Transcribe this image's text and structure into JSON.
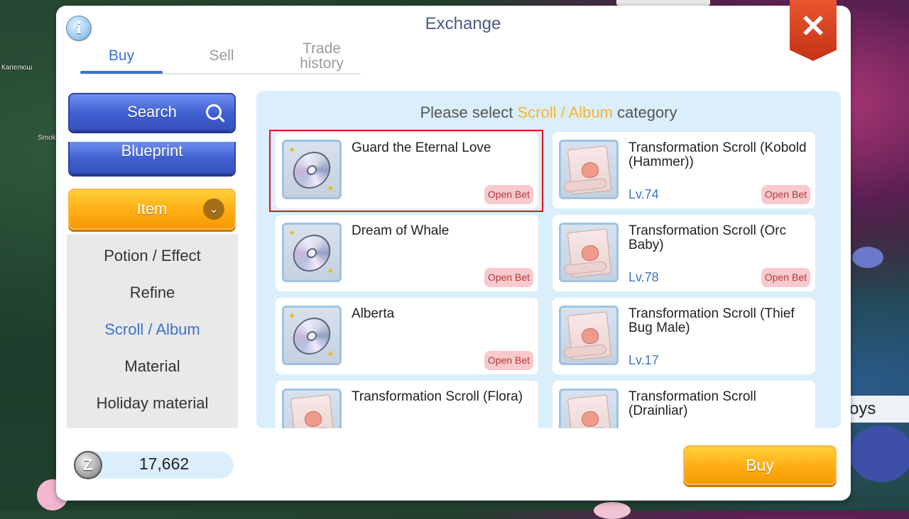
{
  "background": {
    "labels": [
      "Капелюш",
      "Smok"
    ],
    "sign_text": "Toys"
  },
  "window": {
    "title": "Exchange",
    "info_icon": "info-icon",
    "close_icon": "close-icon"
  },
  "tabs": [
    {
      "label": "Buy",
      "active": true
    },
    {
      "label": "Sell",
      "active": false
    },
    {
      "label": "Trade history",
      "active": false
    }
  ],
  "sidebar": {
    "search_label": "Search",
    "blueprint_label": "Blueprint",
    "item_label": "Item",
    "subcategories": [
      {
        "label": "Potion / Effect",
        "active": false
      },
      {
        "label": "Refine",
        "active": false
      },
      {
        "label": "Scroll / Album",
        "active": true
      },
      {
        "label": "Material",
        "active": false
      },
      {
        "label": "Holiday material",
        "active": false
      }
    ]
  },
  "content": {
    "prompt_prefix": "Please select",
    "prompt_highlight": "Scroll / Album",
    "prompt_suffix": "category",
    "items": [
      {
        "name": "Guard the Eternal Love",
        "level": "",
        "badge": "Open Bet",
        "icon": "disc-icon",
        "selected": true
      },
      {
        "name": "Transformation Scroll (Kobold (Hammer))",
        "level": "Lv.74",
        "badge": "Open Bet",
        "icon": "scroll-icon"
      },
      {
        "name": "Dream of Whale",
        "level": "",
        "badge": "Open Bet",
        "icon": "disc-icon"
      },
      {
        "name": "Transformation Scroll (Orc Baby)",
        "level": "Lv.78",
        "badge": "Open Bet",
        "icon": "scroll-icon"
      },
      {
        "name": "Alberta",
        "level": "",
        "badge": "Open Bet",
        "icon": "disc-icon"
      },
      {
        "name": "Transformation Scroll (Thief Bug Male)",
        "level": "Lv.17",
        "badge": "",
        "icon": "scroll-icon"
      },
      {
        "name": "Transformation Scroll (Flora)",
        "level": "",
        "badge": "",
        "icon": "scroll-icon"
      },
      {
        "name": "Transformation Scroll (Drainliar)",
        "level": "",
        "badge": "",
        "icon": "scroll-icon"
      }
    ]
  },
  "footer": {
    "currency_icon": "zeny-icon",
    "currency_amount": "17,662",
    "buy_label": "Buy"
  },
  "colors": {
    "accent_blue": "#3c6fcf",
    "highlight_orange": "#f6b52e",
    "selection_red": "#e0131c"
  }
}
